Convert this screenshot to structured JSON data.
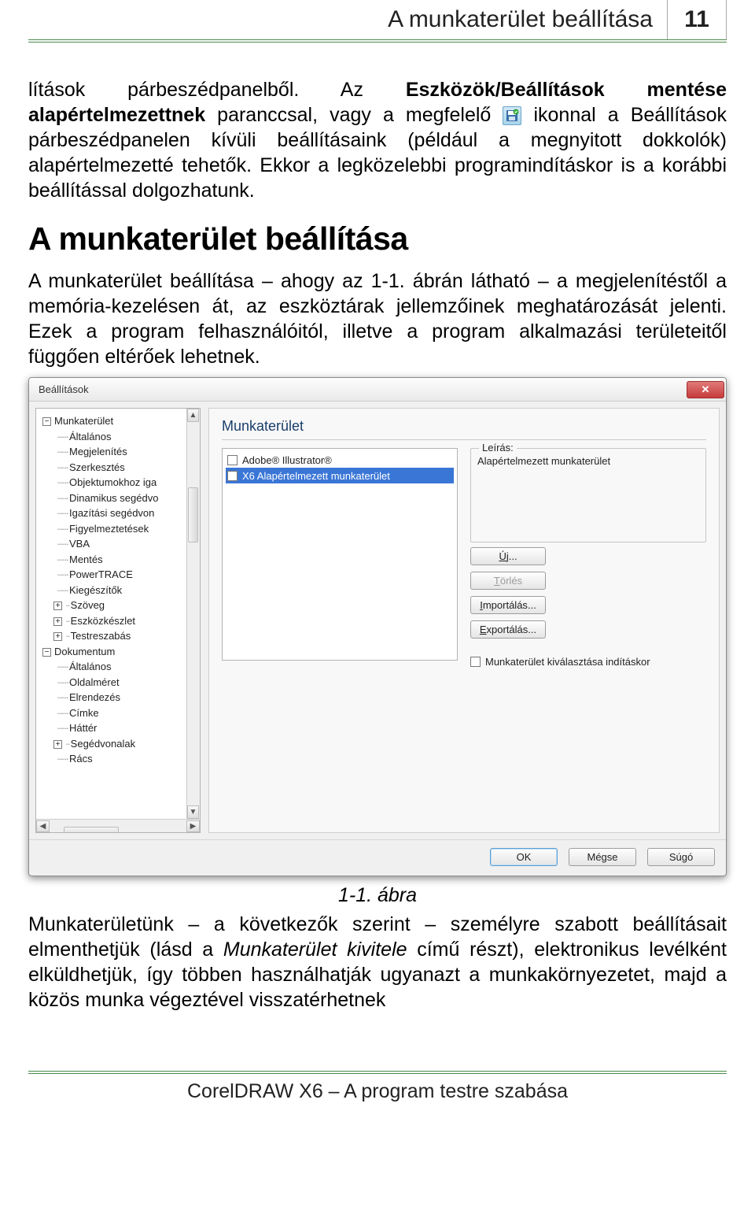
{
  "header": {
    "title": "A munkaterület beállítása",
    "page_number": "11"
  },
  "para1_a": "lítások párbeszédpanelből. Az ",
  "para1_b": "Eszközök/Beállítások mentése alapértelmezettnek",
  "para1_c": " paranccsal, vagy a megfelelő ",
  "para1_d": " ikonnal a Beállítások párbeszédpanelen kívüli beállításaink (például a megnyitott dokkolók) alapértelmezetté tehetők. Ekkor a legközelebbi programindításkor is a korábbi beállítással dolgozhatunk.",
  "section_heading": "A munkaterület beállítása",
  "para2": "A munkaterület beállítása – ahogy az 1-1. ábrán látható – a megjelenítéstől a memória-kezelésen át, az eszköztárak jellemzőinek meghatározását jelenti. Ezek a program felhasználóitól, illetve a program alkalmazási területeitől függően eltérőek lehetnek.",
  "dialog": {
    "title": "Beállítások",
    "tree": {
      "root1": "Munkaterület",
      "root1_items": [
        "Általános",
        "Megjelenítés",
        "Szerkesztés",
        "Objektumokhoz iga",
        "Dinamikus segédvo",
        "Igazítási segédvon",
        "Figyelmeztetések",
        "VBA",
        "Mentés",
        "PowerTRACE",
        "Kiegészítők",
        "Szöveg",
        "Eszközkészlet",
        "Testreszabás"
      ],
      "root2": "Dokumentum",
      "root2_items": [
        "Általános",
        "Oldalméret",
        "Elrendezés",
        "Címke",
        "Háttér",
        "Segédvonalak",
        "Rács"
      ]
    },
    "pane_title": "Munkaterület",
    "list": {
      "item1": "Adobe® Illustrator®",
      "item2": "X6 Alapértelmezett munkaterület"
    },
    "desc_legend": "Leírás:",
    "desc_text": "Alapértelmezett munkaterület",
    "buttons": {
      "new": "Új...",
      "delete": "Törlés",
      "import": "Importálás...",
      "export": "Exportálás..."
    },
    "startup_check": "Munkaterület kiválasztása indításkor",
    "footer": {
      "ok": "OK",
      "cancel": "Mégse",
      "help": "Súgó"
    }
  },
  "figure_caption": "1-1. ábra",
  "para3_a": "Munkaterületünk – a következők szerint – személyre szabott beállításait elmenthetjük (lásd a ",
  "para3_i": "Munkaterület kivitele",
  "para3_b": " című részt), elektronikus levélként elküldhetjük, így többen használhatják ugyanazt a munkakörnyezetet, majd a közös munka végeztével visszatérhetnek",
  "footer_text": "CorelDRAW X6 – A program testre szabása"
}
